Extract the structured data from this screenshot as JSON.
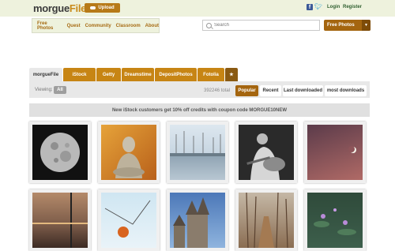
{
  "header": {
    "logo_part1": "morgue",
    "logo_part2": "File",
    "upload_label": "Upload",
    "login": "Login",
    "register": "Register"
  },
  "nav": {
    "items": [
      "Free Photos",
      "Quest",
      "Community",
      "Classroom",
      "About"
    ]
  },
  "search": {
    "placeholder": "Search"
  },
  "free_photos_button": "Free Photos",
  "tabs": [
    "morgueFile",
    "iStock",
    "Getty",
    "Dreamstime",
    "DepositPhotos",
    "Fotolia",
    "★"
  ],
  "filter": {
    "viewing_label": "Viewing:",
    "all_label": "All",
    "total": "392246 total",
    "sort_options": [
      "Popular",
      "Recent",
      "Last downloaded",
      "most downloads"
    ],
    "selected_sort": "Popular"
  },
  "promo_text": "New iStock customers get 10% off credits with coupon code MORGUE10NEW",
  "colors": {
    "brand_orange": "#c78514",
    "header_bg": "#eef2dd",
    "facebook": "#3b5998",
    "twitter": "#2a9fd6"
  },
  "icons": [
    "cloud-upload-icon",
    "facebook-icon",
    "twitter-icon",
    "search-icon",
    "chevron-down-icon",
    "star-icon"
  ]
}
